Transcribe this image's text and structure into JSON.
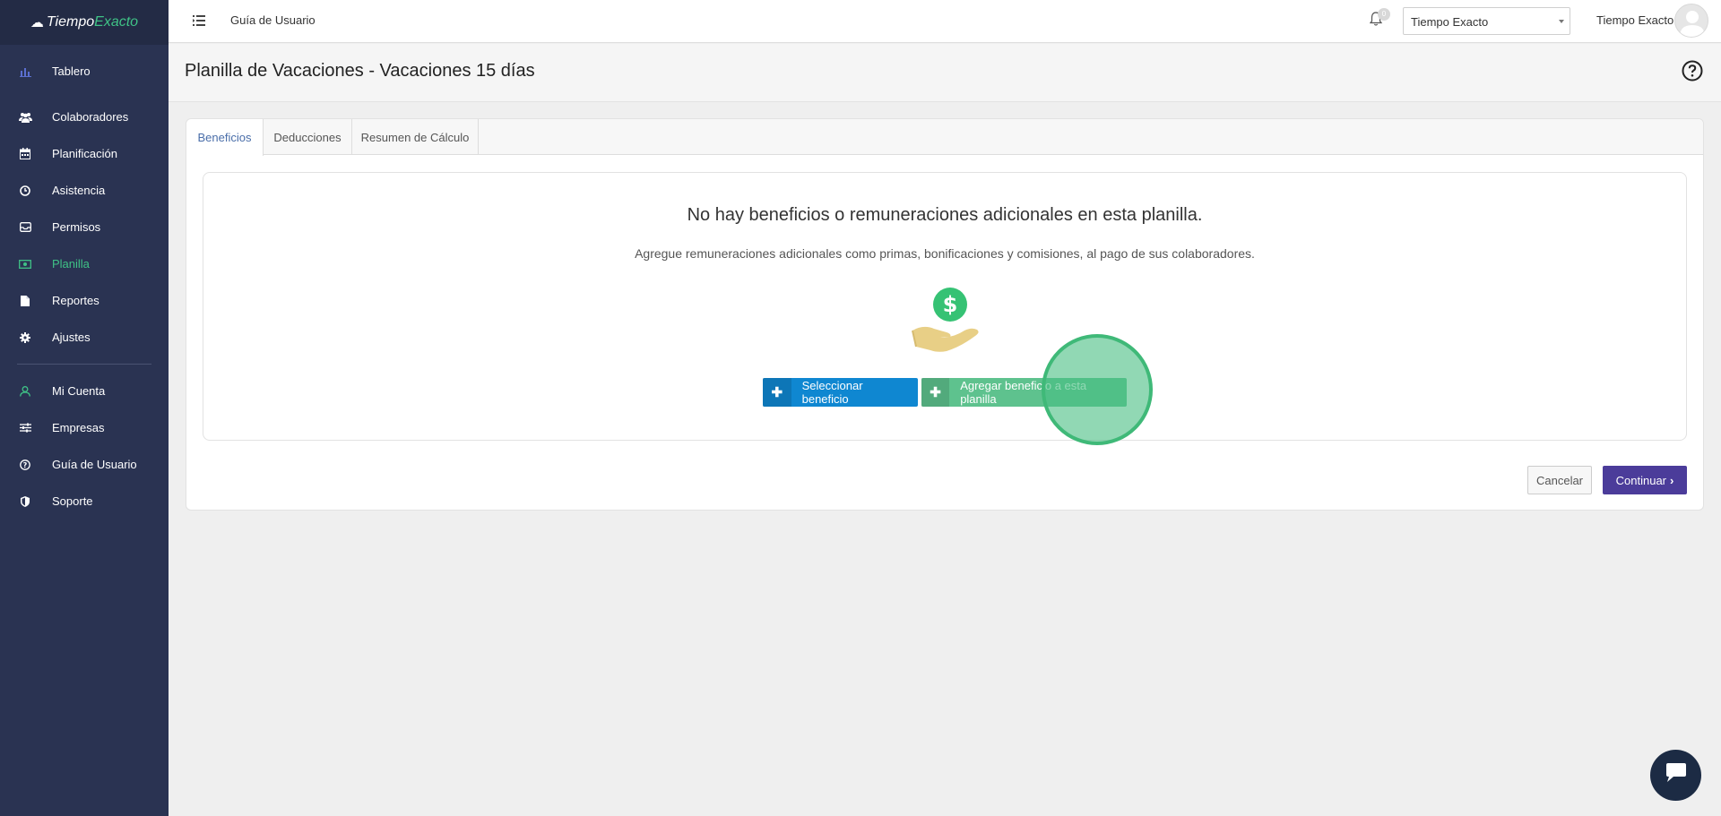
{
  "brand": {
    "part1": "Tiempo",
    "part2": "Exacto"
  },
  "sidebar": {
    "items": [
      {
        "label": "Tablero",
        "icon": "bar-chart-icon"
      },
      {
        "label": "Colaboradores",
        "icon": "users-icon"
      },
      {
        "label": "Planificación",
        "icon": "calendar-icon"
      },
      {
        "label": "Asistencia",
        "icon": "clock-icon"
      },
      {
        "label": "Permisos",
        "icon": "inbox-icon"
      },
      {
        "label": "Planilla",
        "icon": "money-icon",
        "active": true
      },
      {
        "label": "Reportes",
        "icon": "file-icon"
      },
      {
        "label": "Ajustes",
        "icon": "gear-icon"
      },
      {
        "label": "Mi Cuenta",
        "icon": "user-icon"
      },
      {
        "label": "Empresas",
        "icon": "sliders-icon"
      },
      {
        "label": "Guía de Usuario",
        "icon": "question-circle-icon"
      },
      {
        "label": "Soporte",
        "icon": "shield-icon"
      }
    ]
  },
  "topbar": {
    "guide_label": "Guía de Usuario",
    "notification_count": "0",
    "company_selected": "Tiempo Exacto",
    "user_name": "Tiempo Exacto"
  },
  "page": {
    "title": "Planilla de Vacaciones - Vacaciones 15 días"
  },
  "tabs": [
    {
      "label": "Beneficios",
      "active": true
    },
    {
      "label": "Deducciones"
    },
    {
      "label": "Resumen de Cálculo"
    }
  ],
  "empty_state": {
    "title": "No hay beneficios o remuneraciones adicionales en esta planilla.",
    "subtitle": "Agregue remuneraciones adicionales como primas, bonificaciones y comisiones, al pago de sus colaboradores."
  },
  "actions": {
    "select_benefit": "Seleccionar beneficio",
    "add_benefit": "Agregar beneficio a esta planilla",
    "cancel": "Cancelar",
    "continue": "Continuar"
  },
  "colors": {
    "sidebar_bg": "#2a3352",
    "accent_green": "#3fc286",
    "primary_blue": "#0f87d1",
    "success_green": "#5ec28e",
    "continue_purple": "#4b3c9a"
  }
}
